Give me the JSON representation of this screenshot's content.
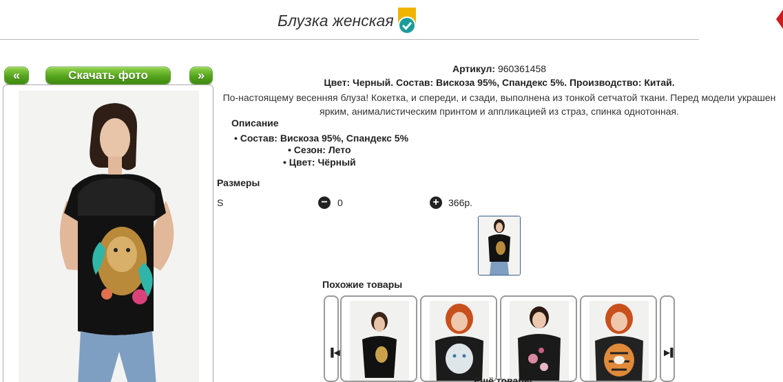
{
  "header": {
    "title": "Блузка женская"
  },
  "gallery": {
    "prev_label": "«",
    "download_label": "Скачать фото",
    "next_label": "»"
  },
  "product": {
    "article_label": "Артикул:",
    "article_value": "960361458",
    "color_line": "Цвет: Черный. Состав: Вискоза 95%, Спандекс 5%. Производство: Китай.",
    "description_line1": "По-настоящему весенняя блуза! Кокетка, и спереди, и сзади, выполнена из тонкой сетчатой ткани. Перед модели украшен",
    "description_line2": "ярким, анималистическим принтом и аппликацией из страз, спинка однотонная.",
    "desc_heading": "Описание",
    "specs": [
      "Состав: Вискоза 95%, Спандекс 5%",
      "Сезон: Лето",
      "Цвет: Чёрный"
    ]
  },
  "sizes": {
    "heading": "Размеры",
    "rows": [
      {
        "size": "S",
        "minus": "−",
        "quantity": "0",
        "plus": "+",
        "price": "366р."
      }
    ]
  },
  "similar": {
    "heading": "Похожие товары",
    "prev_icon": "▐◀",
    "next_icon": "▶▌",
    "items": [
      {
        "shirt_color": "#111111",
        "hair_color": "#3b2518",
        "print": "gold-ornament"
      },
      {
        "shirt_color": "#1b1b1b",
        "hair_color": "#c8501c",
        "print": "white-tiger"
      },
      {
        "shirt_color": "#1a1a1a",
        "hair_color": "#2b1a12",
        "print": "flowers"
      },
      {
        "shirt_color": "#222222",
        "hair_color": "#c8501c",
        "print": "tiger"
      }
    ],
    "more_heading": "Ещё товары:"
  },
  "colors": {
    "accent_green": "#54a41c",
    "badge_yellow": "#f0b400",
    "badge_teal": "#1a9c9c",
    "thumb_border": "#3a5b8c"
  }
}
